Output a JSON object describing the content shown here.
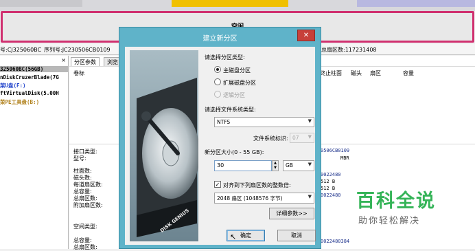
{
  "app": {
    "partition_bar_label": "空闲",
    "disk_info": {
      "model_prefix": "号:CJ325060BC",
      "serial_label": "序列号:JC230506CB0109",
      "sectors_total": "总扇区数:117231408"
    },
    "tree": {
      "close": "×",
      "items": [
        "325060BC(56GB)",
        "nDiskCruzerBlade(7G",
        "菜U盘(F:)",
        "ftVirtualDisk(5.00H",
        "菜PE工具盘(B:)"
      ]
    },
    "tabs": [
      "分区参数",
      "浏览"
    ],
    "columns": {
      "volume_label": "卷标",
      "end_cylinder": "终止柱面",
      "head": "磁头",
      "sector": "扇区",
      "capacity": "容量"
    },
    "properties": {
      "interface_type": "接口类型:",
      "model": "型号:",
      "cylinders": "柱面数:",
      "heads": "磁头数:",
      "sectors_per_track": "每道扇区数:",
      "total_capacity": "总容量:",
      "total_sectors": "总扇区数:",
      "extra_sectors": "附加扇区数:",
      "free_type": "空间类型:",
      "total_capacity_2": "总容量:",
      "total_sectors_2": "总扇区数:"
    },
    "values": {
      "serial": "0506CB0109",
      "mbr": "MBR",
      "v1": "0022480",
      "v2": "512 B",
      "v3": "512 B",
      "v4": "0022480",
      "v5": "0022480384"
    }
  },
  "dialog": {
    "title": "建立新分区",
    "close": "✕",
    "partition_type_label": "请选择分区类型:",
    "partition_types": [
      {
        "label": "主磁盘分区",
        "selected": true,
        "enabled": true
      },
      {
        "label": "扩展磁盘分区",
        "selected": false,
        "enabled": true
      },
      {
        "label": "逻辑分区",
        "selected": false,
        "enabled": false
      }
    ],
    "fs_label": "请选择文件系统类型:",
    "fs_value": "NTFS",
    "fs_id_label": "文件系统标识:",
    "fs_id_value": "07",
    "size_label": "新分区大小(0 - 55 GB):",
    "size_value": "30",
    "size_unit": "GB",
    "align_checked": true,
    "align_label": "对齐到下列扇区数的整数倍:",
    "align_value": "2048 扇区 (1048576 字节)",
    "details_button": "详细参数>>",
    "ok_button": "确定",
    "cancel_button": "取消",
    "hdd_brand": "DISK GENIUS"
  },
  "watermark": {
    "title": "百科全说",
    "subtitle": "助你轻松解决"
  },
  "colors": {
    "dialog_frame": "#5fb3c9",
    "partition_border": "#d0306f",
    "close_button": "#c7403a",
    "watermark_green": "#35b458"
  }
}
